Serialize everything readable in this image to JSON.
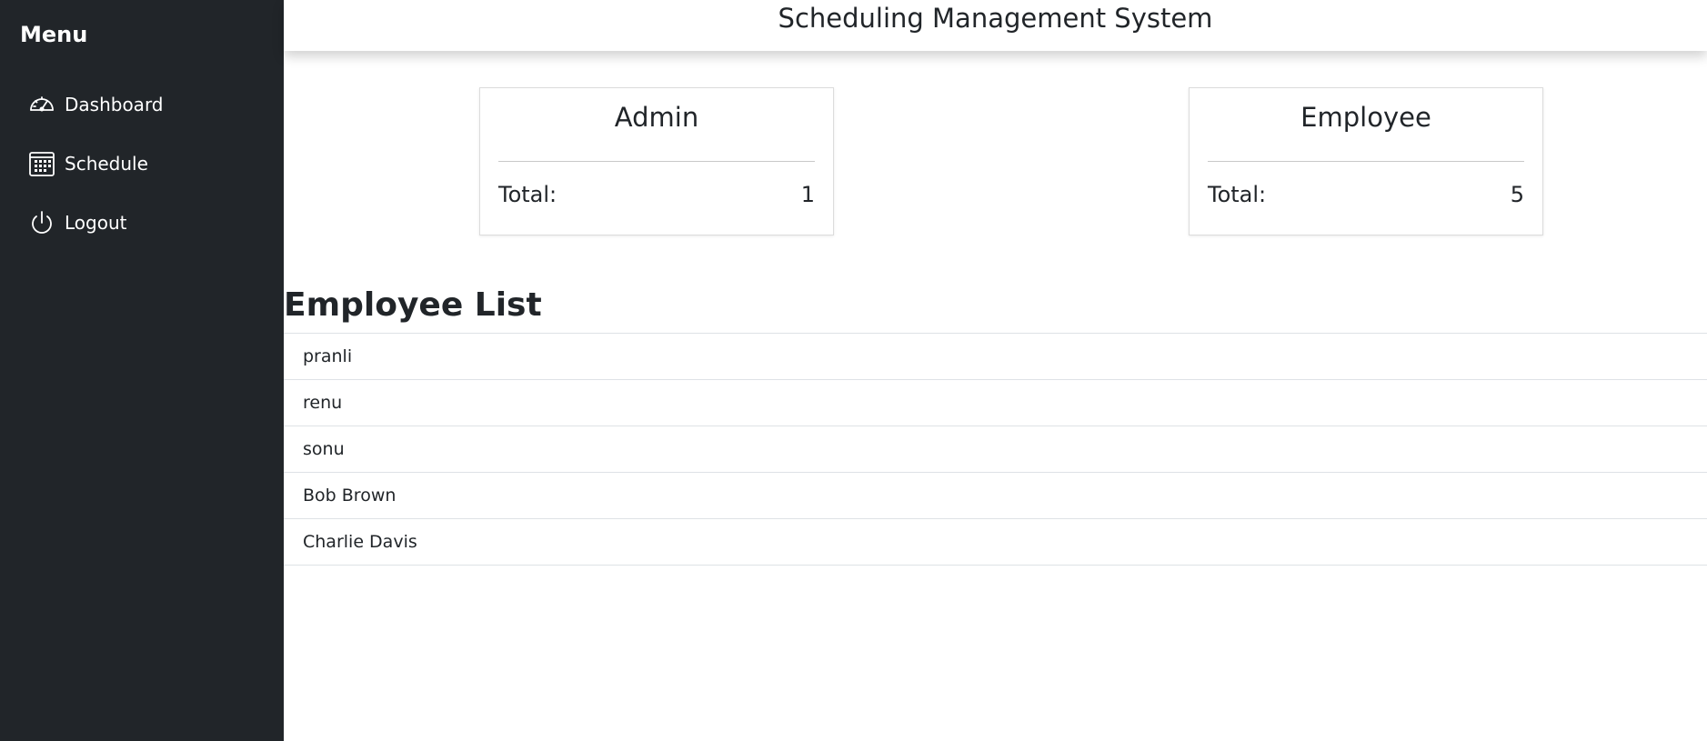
{
  "sidebar": {
    "title": "Menu",
    "items": [
      {
        "label": "Dashboard",
        "icon": "speedometer-icon"
      },
      {
        "label": "Schedule",
        "icon": "calendar-icon"
      },
      {
        "label": "Logout",
        "icon": "power-icon"
      }
    ]
  },
  "header": {
    "title": "Scheduling Management System"
  },
  "cards": [
    {
      "title": "Admin",
      "total_label": "Total:",
      "total_value": "1"
    },
    {
      "title": "Employee",
      "total_label": "Total:",
      "total_value": "5"
    }
  ],
  "employee_list": {
    "title": "Employee List",
    "items": [
      "pranli",
      "renu",
      "sonu",
      "Bob Brown",
      "Charlie Davis"
    ]
  },
  "colors": {
    "sidebar_bg": "#212529",
    "text": "#212529",
    "border": "#dee2e6"
  }
}
